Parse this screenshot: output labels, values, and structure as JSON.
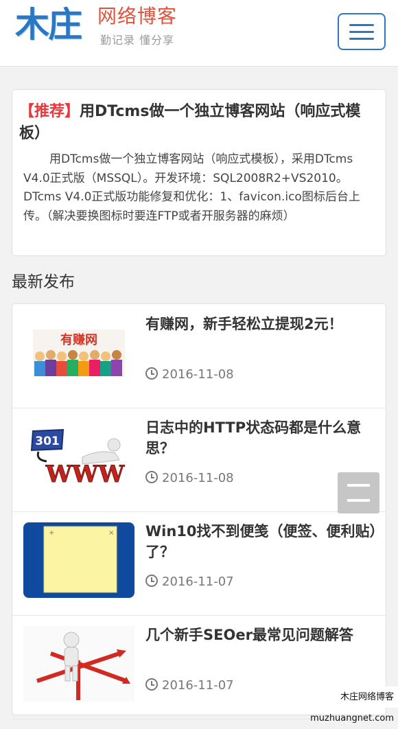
{
  "header": {
    "logo_mark": "木庄",
    "logo_name": "网络博客",
    "logo_tagline": "勤记录 懂分享"
  },
  "featured": {
    "tag": "【推荐】",
    "title": "用DTcms做一个独立博客网站（响应式模板）",
    "summary": "用DTcms做一个独立博客网站（响应式模板），采用DTcms V4.0正式版（MSSQL）。开发环境：SQL2008R2+VS2010。DTcms V4.0正式版功能修复和优化：1、favicon.ico图标后台上传。（解决要换图标时要连FTP或者开服务器的麻烦）"
  },
  "section": {
    "title": "最新发布"
  },
  "posts": [
    {
      "title": "有赚网，新手轻松立提现2元！",
      "date": "2016-11-08",
      "thumb_text": "有赚网"
    },
    {
      "title": "日志中的HTTP状态码都是什么意思？",
      "date": "2016-11-08",
      "thumb_badge": "301",
      "thumb_text": "WWW"
    },
    {
      "title": "Win10找不到便笺（便签、便利贴）了？",
      "date": "2016-11-07"
    },
    {
      "title": "几个新手SEOer最常见问题解答",
      "date": "2016-11-07"
    }
  ],
  "watermark": "木庄网络博客 muzhuangnet.com",
  "icons": {
    "menu": "hamburger-menu-icon",
    "float": "floating-menu-icon",
    "date": "clock-icon"
  },
  "colors": {
    "brand_blue": "#2a78c4",
    "brand_red": "#e4513a",
    "tag_red": "#e4393c"
  }
}
